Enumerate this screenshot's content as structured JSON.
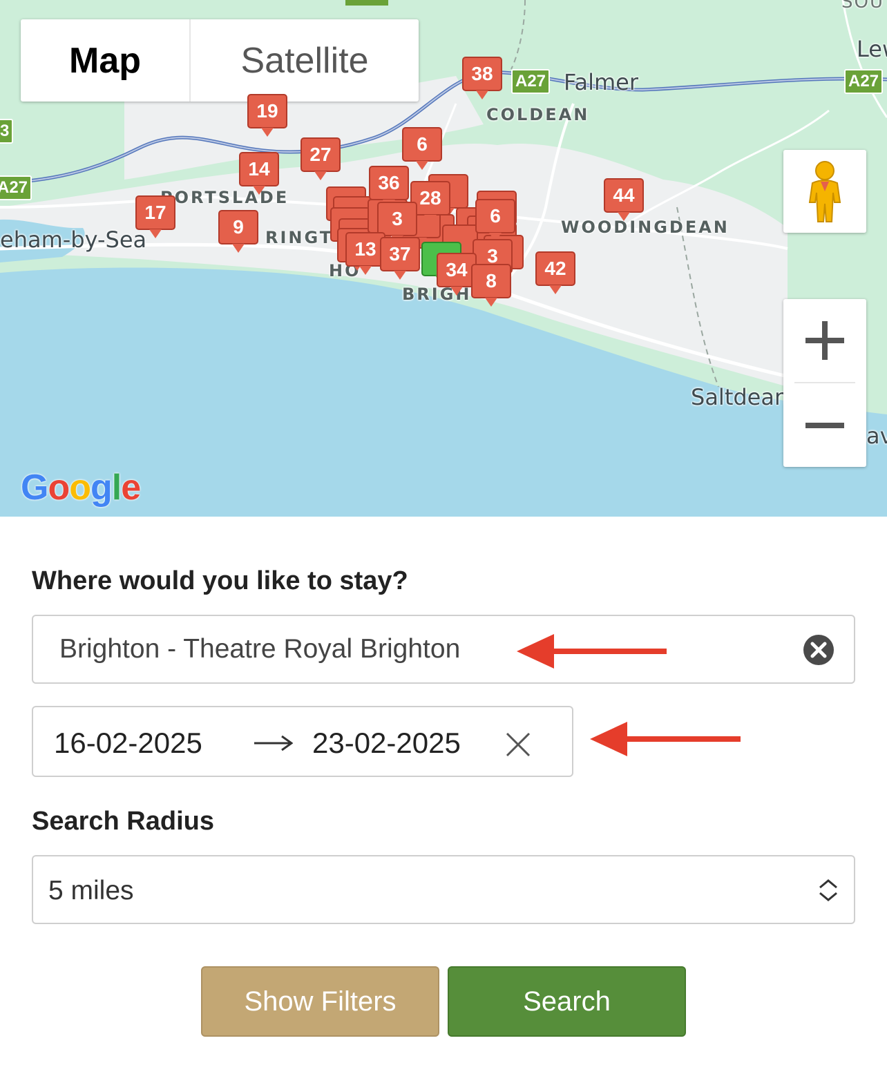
{
  "map": {
    "type_control": {
      "map_label": "Map",
      "satellite_label": "Satellite",
      "active": "Map"
    },
    "labels": {
      "sou": "SOU",
      "lew": "Lew",
      "falmer": "Falmer",
      "coldean": "COLDEAN",
      "portslade": "PORTSLADE",
      "shoreham": "eham-by-Sea",
      "hove_partial": "RINGT",
      "hove": "HO",
      "brighton": "BRIGH",
      "woodingdean": "WOODINGDEAN",
      "saltdean": "Saltdean",
      "av": "av"
    },
    "roads": [
      "A27",
      "A27",
      "A27",
      "3"
    ],
    "markers": [
      "38",
      "19",
      "14",
      "27",
      "6",
      "36",
      "17",
      "9",
      "44",
      "13",
      "37",
      "34",
      "8",
      "42",
      "3",
      "3",
      "28",
      "6"
    ],
    "logo": "Google",
    "icons": {
      "pegman": "pegman-icon",
      "zoom_in": "plus-icon",
      "zoom_out": "minus-icon"
    }
  },
  "form": {
    "where_label": "Where would you like to stay?",
    "location_value": "Brighton - Theatre Royal Brighton",
    "date_start": "16-02-2025",
    "date_end": "23-02-2025",
    "radius_label": "Search Radius",
    "radius_value": "5 miles",
    "show_filters_label": "Show Filters",
    "search_label": "Search"
  },
  "colors": {
    "marker": "#e4604b",
    "marker_selected": "#4cbf4a",
    "search_button": "#568e3a",
    "filters_button": "#c3a774",
    "annotation_arrow": "#e53d2b",
    "sea": "#a5d8ea",
    "land": "#cfeedd"
  }
}
